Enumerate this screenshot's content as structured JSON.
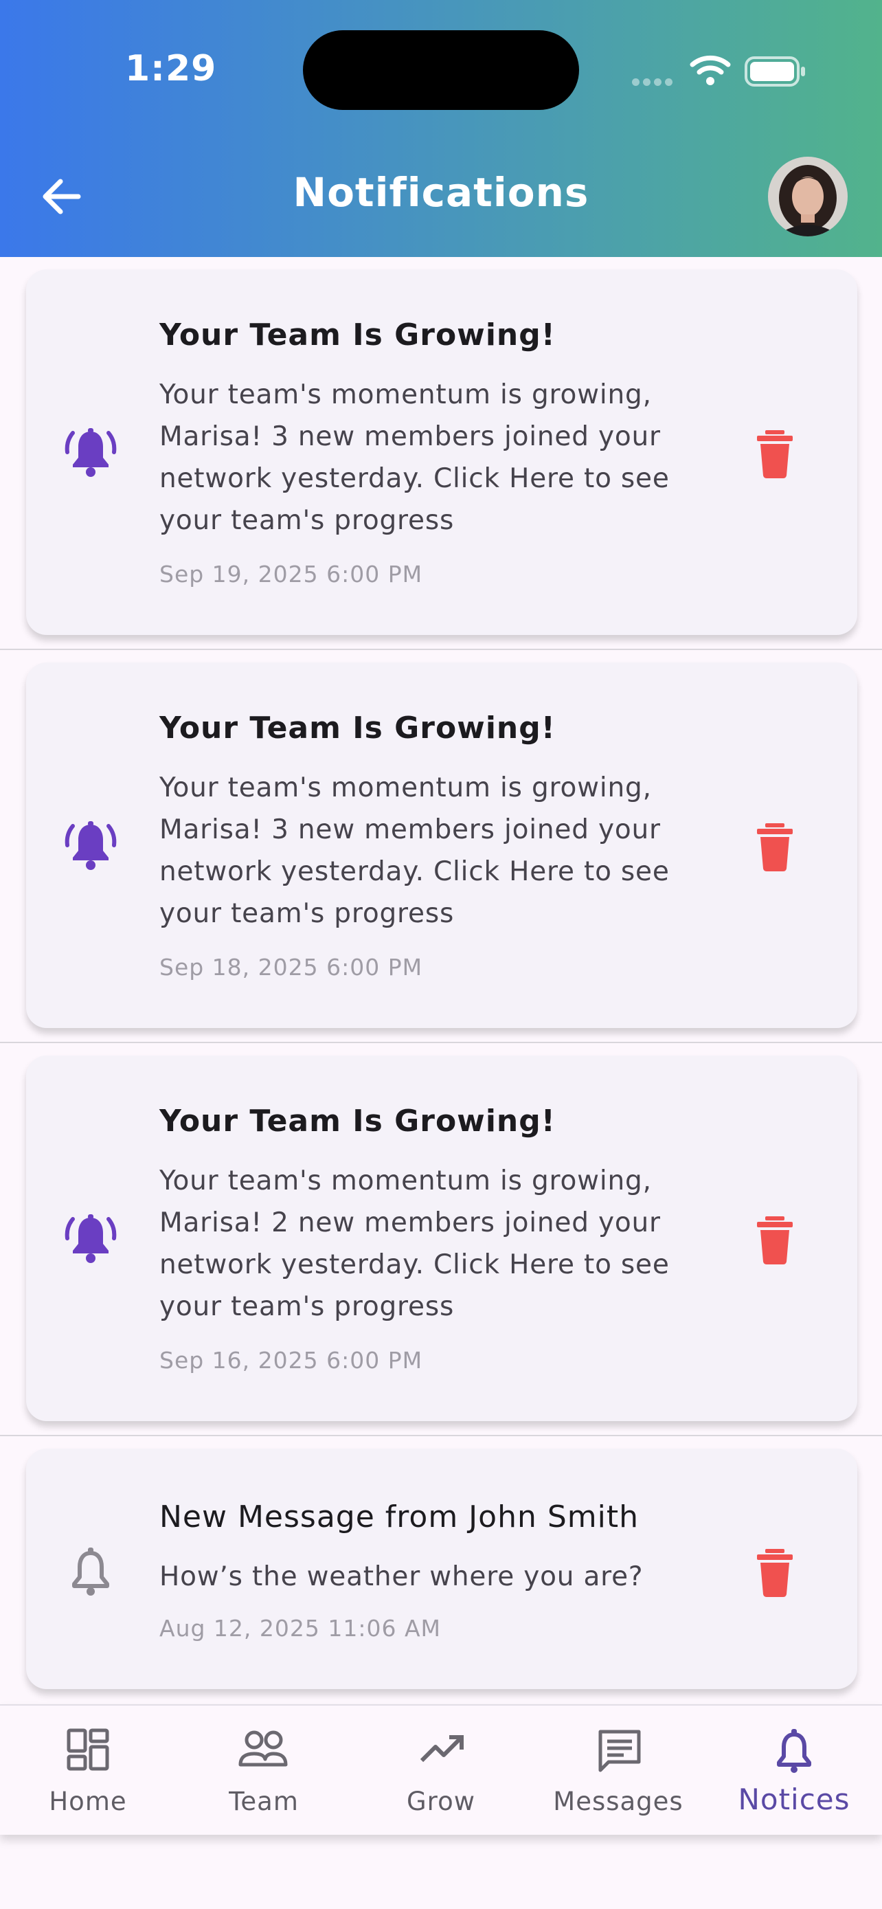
{
  "status": {
    "time": "1:29"
  },
  "header": {
    "title": "Notifications"
  },
  "notifications": [
    {
      "title": "Your Team Is Growing!",
      "body": "Your team's momentum is growing, Marisa! 3 new members joined your network yesterday. Click Here to see your team's progress",
      "date": "Sep 19, 2025 6:00 PM",
      "unread": true
    },
    {
      "title": "Your Team Is Growing!",
      "body": "Your team's momentum is growing, Marisa! 3 new members joined your network yesterday. Click Here to see your team's progress",
      "date": "Sep 18, 2025 6:00 PM",
      "unread": true
    },
    {
      "title": "Your Team Is Growing!",
      "body": "Your team's momentum is growing, Marisa! 2 new members joined your network yesterday. Click Here to see your team's progress",
      "date": "Sep 16, 2025 6:00 PM",
      "unread": true
    },
    {
      "title": "New Message from John Smith",
      "body": "How’s the weather where you are?",
      "date": "Aug 12, 2025 11:06 AM",
      "unread": false
    }
  ],
  "nav": {
    "items": [
      {
        "label": "Home",
        "icon": "dashboard-icon"
      },
      {
        "label": "Team",
        "icon": "people-icon"
      },
      {
        "label": "Grow",
        "icon": "trending-up-icon"
      },
      {
        "label": "Messages",
        "icon": "message-icon"
      },
      {
        "label": "Notices",
        "icon": "bell-icon"
      }
    ],
    "active": "Notices"
  },
  "colors": {
    "header_start": "#3b78ea",
    "header_end": "#52b38c",
    "accent": "#6a3ec2",
    "delete": "#f0514f",
    "card_bg": "#f5f2f9"
  }
}
